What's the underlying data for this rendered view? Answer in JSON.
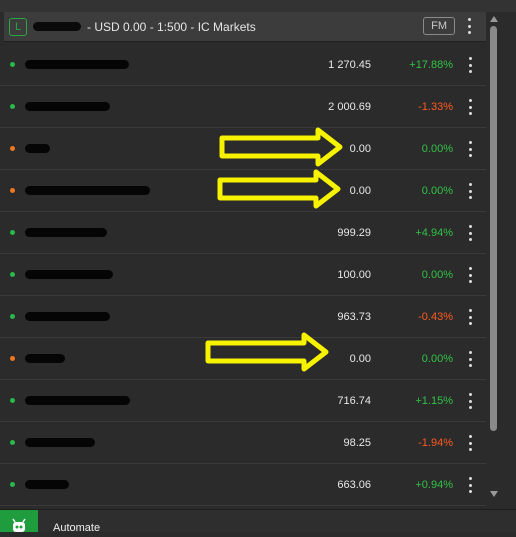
{
  "header": {
    "badge": "L",
    "account_text": "- USD 0.00 - 1:500 - IC Markets",
    "fm_label": "FM"
  },
  "colors": {
    "positive": "#32c247",
    "negative": "#ff5a1f",
    "status_green": "#29b84a",
    "status_orange": "#f07820",
    "arrow": "#f7f200"
  },
  "rows": [
    {
      "status": "green",
      "balance": "1 270.45",
      "change": "+17.88%",
      "trend": "positive"
    },
    {
      "status": "green",
      "balance": "2 000.69",
      "change": "-1.33%",
      "trend": "negative"
    },
    {
      "status": "orange",
      "balance": "0.00",
      "change": "0.00%",
      "trend": "positive"
    },
    {
      "status": "orange",
      "balance": "0.00",
      "change": "0.00%",
      "trend": "positive"
    },
    {
      "status": "green",
      "balance": "999.29",
      "change": "+4.94%",
      "trend": "positive"
    },
    {
      "status": "green",
      "balance": "100.00",
      "change": "0.00%",
      "trend": "positive"
    },
    {
      "status": "green",
      "balance": "963.73",
      "change": "-0.43%",
      "trend": "negative"
    },
    {
      "status": "orange",
      "balance": "0.00",
      "change": "0.00%",
      "trend": "positive"
    },
    {
      "status": "green",
      "balance": "716.74",
      "change": "+1.15%",
      "trend": "positive"
    },
    {
      "status": "green",
      "balance": "98.25",
      "change": "-1.94%",
      "trend": "negative"
    },
    {
      "status": "green",
      "balance": "663.06",
      "change": "+0.94%",
      "trend": "positive"
    }
  ],
  "bottom": {
    "label": "Automate",
    "icon": "robot-icon"
  }
}
